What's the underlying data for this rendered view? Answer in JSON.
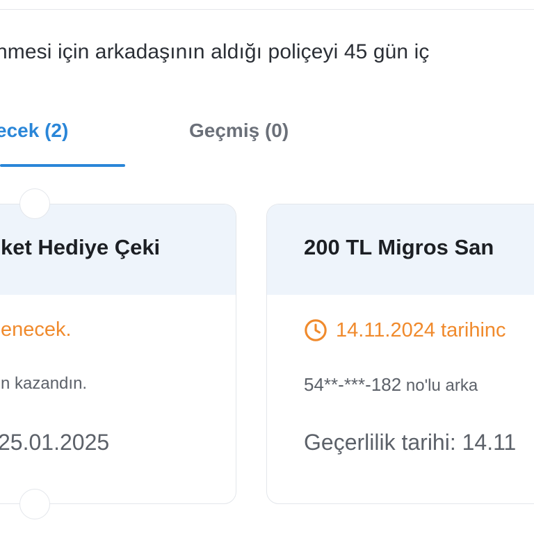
{
  "intro_text": "nmesi için arkadaşının aldığı poliçeyi 45 gün iç",
  "tabs": [
    {
      "label": "ecek (2)",
      "active": true
    },
    {
      "label": "Geçmiş (0)",
      "active": false
    }
  ],
  "cards": [
    {
      "title": "ket Hediye Çeki",
      "status": "enecek.",
      "description": "n kazandın.",
      "validity": "25.01.2025"
    },
    {
      "title": "200 TL Migros San",
      "status": "14.11.2024 tarihinc",
      "description_number": "54**-***-182",
      "description_rest": " no'lu arka",
      "validity": "Geçerlilik tarihi: 14.11"
    }
  ],
  "colors": {
    "accent": "#2a86d8",
    "status": "#f08a2c",
    "card_header": "#eef4fb"
  },
  "icons": {
    "status_icon": "clock-icon"
  }
}
